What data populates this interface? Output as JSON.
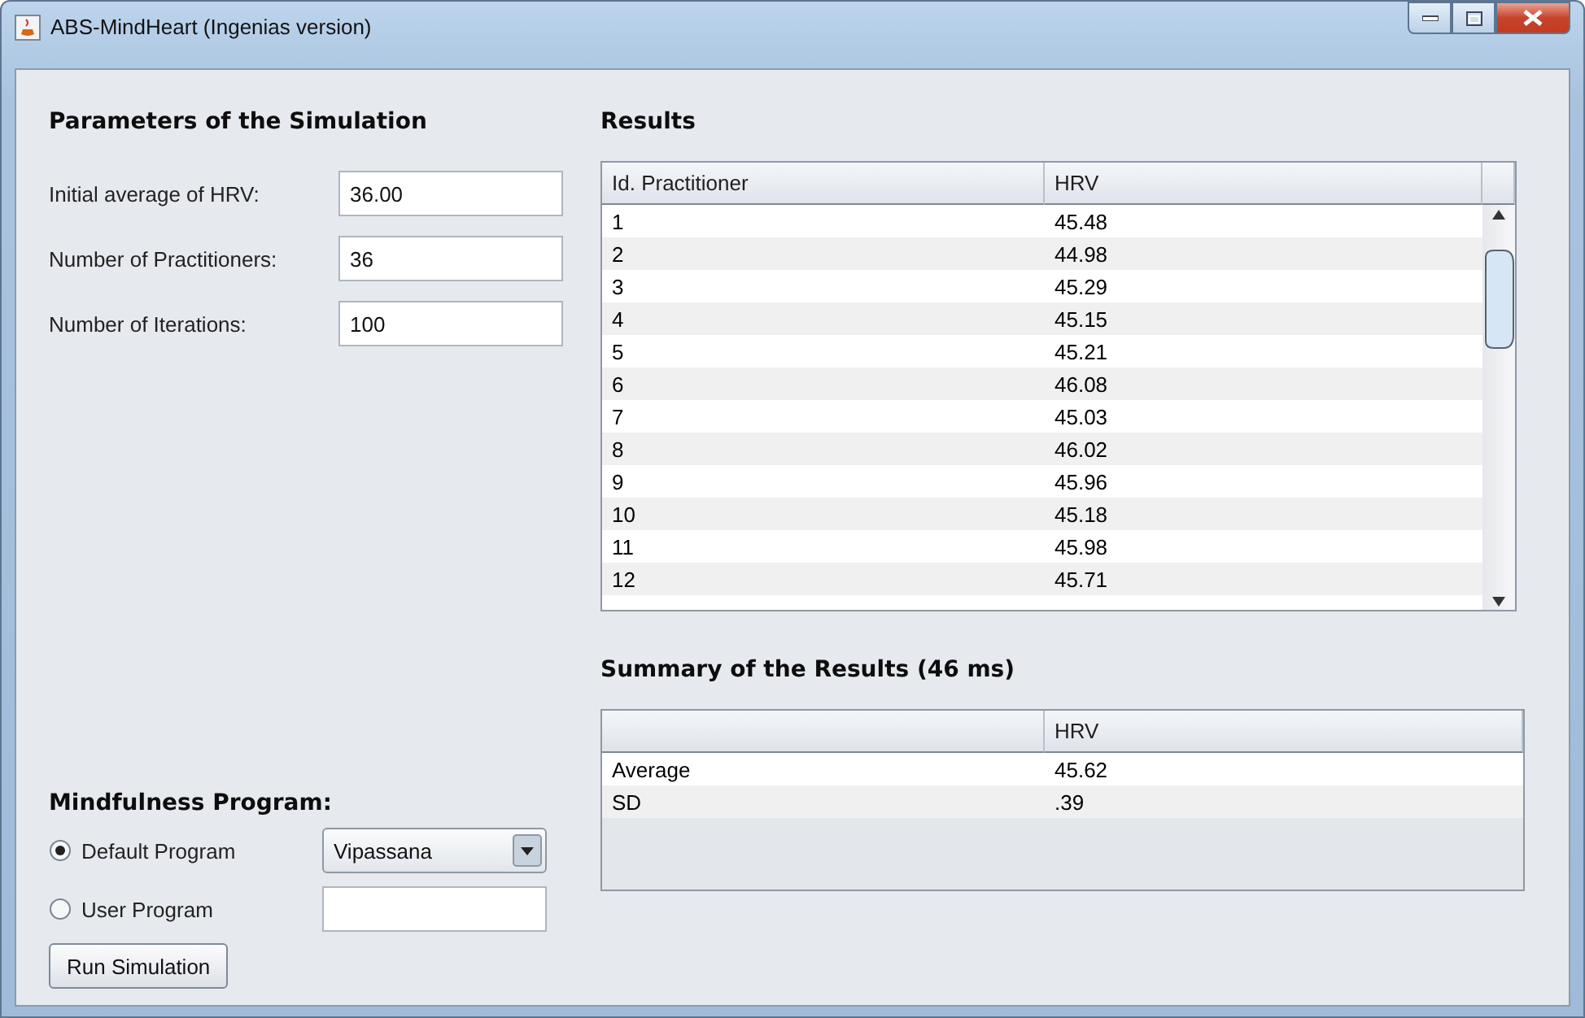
{
  "window": {
    "title": "ABS-MindHeart (Ingenias version)"
  },
  "parameters": {
    "heading": "Parameters of the Simulation",
    "fields": [
      {
        "label": "Initial average of HRV:",
        "value": "36.00"
      },
      {
        "label": "Number of Practitioners:",
        "value": "36"
      },
      {
        "label": "Number of Iterations:",
        "value": "100"
      }
    ]
  },
  "program": {
    "heading": "Mindfulness Program:",
    "options": [
      {
        "kind": "dropdown",
        "label": "Default Program",
        "selected": true,
        "value": "Vipassana"
      },
      {
        "kind": "text",
        "label": "User Program",
        "selected": false
      }
    ],
    "run_button": "Run Simulation"
  },
  "results": {
    "heading": "Results",
    "columns": [
      "Id. Practitioner",
      "HRV"
    ],
    "rows": [
      [
        "1",
        "45.48"
      ],
      [
        "2",
        "44.98"
      ],
      [
        "3",
        "45.29"
      ],
      [
        "4",
        "45.15"
      ],
      [
        "5",
        "45.21"
      ],
      [
        "6",
        "46.08"
      ],
      [
        "7",
        "45.03"
      ],
      [
        "8",
        "46.02"
      ],
      [
        "9",
        "45.96"
      ],
      [
        "10",
        "45.18"
      ],
      [
        "11",
        "45.98"
      ],
      [
        "12",
        "45.71"
      ]
    ]
  },
  "summary": {
    "heading": "Summary of the Results (46 ms)",
    "columns": [
      "",
      "HRV"
    ],
    "rows": [
      [
        "Average",
        "45.62"
      ],
      [
        "SD",
        ".39"
      ]
    ]
  }
}
